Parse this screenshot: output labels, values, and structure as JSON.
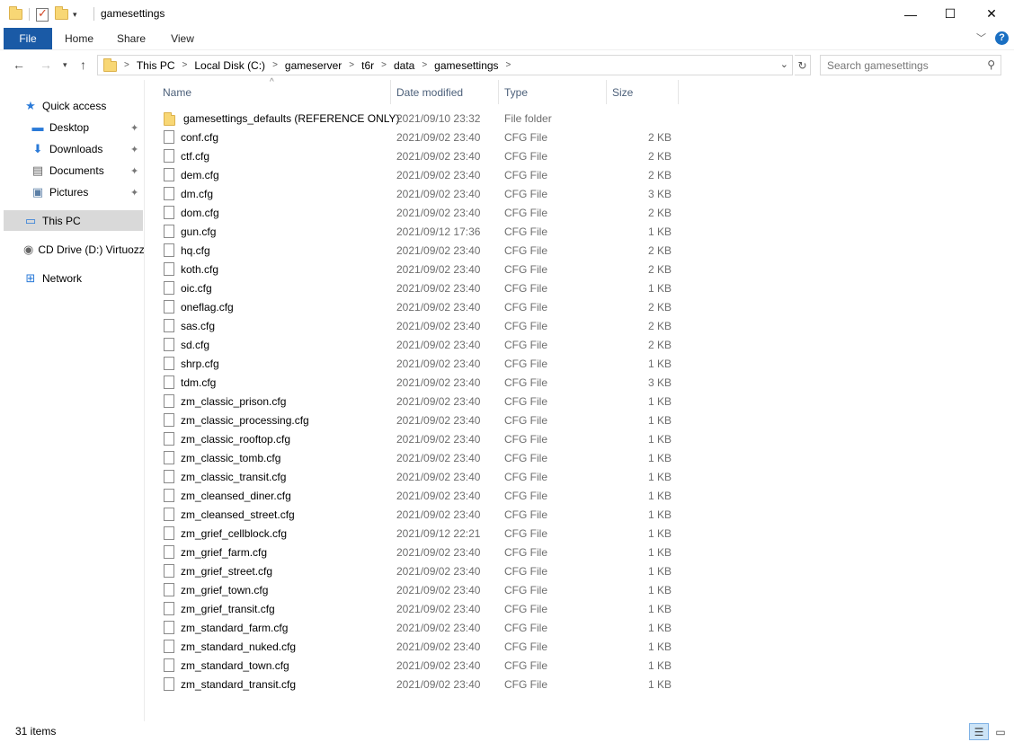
{
  "window": {
    "title": "gamesettings",
    "controls": {
      "minimize": "—",
      "maximize": "☐",
      "close": "✕"
    }
  },
  "ribbon": {
    "tabs": [
      "File",
      "Home",
      "Share",
      "View"
    ],
    "help": "?"
  },
  "address": {
    "crumbs": [
      "This PC",
      "Local Disk (C:)",
      "gameserver",
      "t6r",
      "data",
      "gamesettings"
    ],
    "search_placeholder": "Search gamesettings"
  },
  "sidebar": {
    "quick_access": "Quick access",
    "pinned": [
      {
        "label": "Desktop",
        "icon": "desktop-icon"
      },
      {
        "label": "Downloads",
        "icon": "download-icon"
      },
      {
        "label": "Documents",
        "icon": "document-icon"
      },
      {
        "label": "Pictures",
        "icon": "pictures-icon"
      }
    ],
    "this_pc": "This PC",
    "cd_drive": "CD Drive (D:) Virtuozzo",
    "network": "Network"
  },
  "columns": {
    "name": "Name",
    "date": "Date modified",
    "type": "Type",
    "size": "Size"
  },
  "files": [
    {
      "name": "gamesettings_defaults (REFERENCE ONLY)",
      "date": "2021/09/10 23:32",
      "type": "File folder",
      "size": "",
      "folder": true
    },
    {
      "name": "conf.cfg",
      "date": "2021/09/02 23:40",
      "type": "CFG File",
      "size": "2 KB"
    },
    {
      "name": "ctf.cfg",
      "date": "2021/09/02 23:40",
      "type": "CFG File",
      "size": "2 KB"
    },
    {
      "name": "dem.cfg",
      "date": "2021/09/02 23:40",
      "type": "CFG File",
      "size": "2 KB"
    },
    {
      "name": "dm.cfg",
      "date": "2021/09/02 23:40",
      "type": "CFG File",
      "size": "3 KB"
    },
    {
      "name": "dom.cfg",
      "date": "2021/09/02 23:40",
      "type": "CFG File",
      "size": "2 KB"
    },
    {
      "name": "gun.cfg",
      "date": "2021/09/12 17:36",
      "type": "CFG File",
      "size": "1 KB"
    },
    {
      "name": "hq.cfg",
      "date": "2021/09/02 23:40",
      "type": "CFG File",
      "size": "2 KB"
    },
    {
      "name": "koth.cfg",
      "date": "2021/09/02 23:40",
      "type": "CFG File",
      "size": "2 KB"
    },
    {
      "name": "oic.cfg",
      "date": "2021/09/02 23:40",
      "type": "CFG File",
      "size": "1 KB"
    },
    {
      "name": "oneflag.cfg",
      "date": "2021/09/02 23:40",
      "type": "CFG File",
      "size": "2 KB"
    },
    {
      "name": "sas.cfg",
      "date": "2021/09/02 23:40",
      "type": "CFG File",
      "size": "2 KB"
    },
    {
      "name": "sd.cfg",
      "date": "2021/09/02 23:40",
      "type": "CFG File",
      "size": "2 KB"
    },
    {
      "name": "shrp.cfg",
      "date": "2021/09/02 23:40",
      "type": "CFG File",
      "size": "1 KB"
    },
    {
      "name": "tdm.cfg",
      "date": "2021/09/02 23:40",
      "type": "CFG File",
      "size": "3 KB"
    },
    {
      "name": "zm_classic_prison.cfg",
      "date": "2021/09/02 23:40",
      "type": "CFG File",
      "size": "1 KB"
    },
    {
      "name": "zm_classic_processing.cfg",
      "date": "2021/09/02 23:40",
      "type": "CFG File",
      "size": "1 KB"
    },
    {
      "name": "zm_classic_rooftop.cfg",
      "date": "2021/09/02 23:40",
      "type": "CFG File",
      "size": "1 KB"
    },
    {
      "name": "zm_classic_tomb.cfg",
      "date": "2021/09/02 23:40",
      "type": "CFG File",
      "size": "1 KB"
    },
    {
      "name": "zm_classic_transit.cfg",
      "date": "2021/09/02 23:40",
      "type": "CFG File",
      "size": "1 KB"
    },
    {
      "name": "zm_cleansed_diner.cfg",
      "date": "2021/09/02 23:40",
      "type": "CFG File",
      "size": "1 KB"
    },
    {
      "name": "zm_cleansed_street.cfg",
      "date": "2021/09/02 23:40",
      "type": "CFG File",
      "size": "1 KB"
    },
    {
      "name": "zm_grief_cellblock.cfg",
      "date": "2021/09/12 22:21",
      "type": "CFG File",
      "size": "1 KB"
    },
    {
      "name": "zm_grief_farm.cfg",
      "date": "2021/09/02 23:40",
      "type": "CFG File",
      "size": "1 KB"
    },
    {
      "name": "zm_grief_street.cfg",
      "date": "2021/09/02 23:40",
      "type": "CFG File",
      "size": "1 KB"
    },
    {
      "name": "zm_grief_town.cfg",
      "date": "2021/09/02 23:40",
      "type": "CFG File",
      "size": "1 KB"
    },
    {
      "name": "zm_grief_transit.cfg",
      "date": "2021/09/02 23:40",
      "type": "CFG File",
      "size": "1 KB"
    },
    {
      "name": "zm_standard_farm.cfg",
      "date": "2021/09/02 23:40",
      "type": "CFG File",
      "size": "1 KB"
    },
    {
      "name": "zm_standard_nuked.cfg",
      "date": "2021/09/02 23:40",
      "type": "CFG File",
      "size": "1 KB"
    },
    {
      "name": "zm_standard_town.cfg",
      "date": "2021/09/02 23:40",
      "type": "CFG File",
      "size": "1 KB"
    },
    {
      "name": "zm_standard_transit.cfg",
      "date": "2021/09/02 23:40",
      "type": "CFG File",
      "size": "1 KB"
    }
  ],
  "status": {
    "items": "31 items"
  },
  "colors": {
    "accent": "#1a5aa6",
    "selected": "#d9d9d9",
    "header_text": "#4c607a"
  }
}
